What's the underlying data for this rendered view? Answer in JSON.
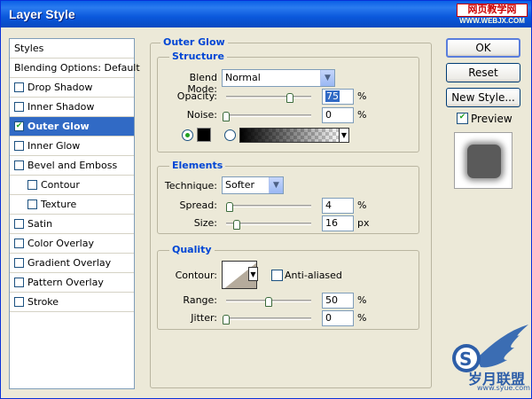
{
  "window": {
    "title": "Layer Style",
    "watermark_top": "网页教学网",
    "watermark_url": "WWW.WEBJX.COM"
  },
  "styles_panel": {
    "items": [
      {
        "label": "Styles",
        "checkbox": false,
        "checked": false,
        "indent": false,
        "selected": false
      },
      {
        "label": "Blending Options: Default",
        "checkbox": false,
        "checked": false,
        "indent": false,
        "selected": false
      },
      {
        "label": "Drop Shadow",
        "checkbox": true,
        "checked": false,
        "indent": false,
        "selected": false
      },
      {
        "label": "Inner Shadow",
        "checkbox": true,
        "checked": false,
        "indent": false,
        "selected": false
      },
      {
        "label": "Outer Glow",
        "checkbox": true,
        "checked": true,
        "indent": false,
        "selected": true
      },
      {
        "label": "Inner Glow",
        "checkbox": true,
        "checked": false,
        "indent": false,
        "selected": false
      },
      {
        "label": "Bevel and Emboss",
        "checkbox": true,
        "checked": false,
        "indent": false,
        "selected": false
      },
      {
        "label": "Contour",
        "checkbox": true,
        "checked": false,
        "indent": true,
        "selected": false
      },
      {
        "label": "Texture",
        "checkbox": true,
        "checked": false,
        "indent": true,
        "selected": false
      },
      {
        "label": "Satin",
        "checkbox": true,
        "checked": false,
        "indent": false,
        "selected": false
      },
      {
        "label": "Color Overlay",
        "checkbox": true,
        "checked": false,
        "indent": false,
        "selected": false
      },
      {
        "label": "Gradient Overlay",
        "checkbox": true,
        "checked": false,
        "indent": false,
        "selected": false
      },
      {
        "label": "Pattern Overlay",
        "checkbox": true,
        "checked": false,
        "indent": false,
        "selected": false
      },
      {
        "label": "Stroke",
        "checkbox": true,
        "checked": false,
        "indent": false,
        "selected": false
      }
    ]
  },
  "outer_glow": {
    "title": "Outer Glow",
    "structure": {
      "title": "Structure",
      "blend_mode_label": "Blend Mode:",
      "blend_mode_value": "Normal",
      "opacity_label": "Opacity:",
      "opacity_value": "75",
      "opacity_unit": "%",
      "opacity_level": 0.75,
      "noise_label": "Noise:",
      "noise_value": "0",
      "noise_unit": "%",
      "noise_level": 0,
      "color_selected": "solid",
      "glow_color": "#000000"
    },
    "elements": {
      "title": "Elements",
      "technique_label": "Technique:",
      "technique_value": "Softer",
      "spread_label": "Spread:",
      "spread_value": "4",
      "spread_unit": "%",
      "spread_level": 0.04,
      "size_label": "Size:",
      "size_value": "16",
      "size_unit": "px",
      "size_level": 0.066
    },
    "quality": {
      "title": "Quality",
      "contour_label": "Contour:",
      "anti_aliased_label": "Anti-aliased",
      "anti_aliased_checked": false,
      "range_label": "Range:",
      "range_value": "50",
      "range_unit": "%",
      "range_level": 0.5,
      "jitter_label": "Jitter:",
      "jitter_value": "0",
      "jitter_unit": "%",
      "jitter_level": 0
    }
  },
  "buttons": {
    "ok": "OK",
    "reset": "Reset",
    "new_style": "New Style...",
    "preview_label": "Preview",
    "preview_checked": true
  },
  "logo": {
    "letter": "S",
    "text": "岁月联盟",
    "url": "www.syue.com"
  },
  "colors": {
    "title_bar": "#0a58dc",
    "selection": "#316ac5",
    "group_title": "#0046d5",
    "checkmark": "#21a121"
  }
}
